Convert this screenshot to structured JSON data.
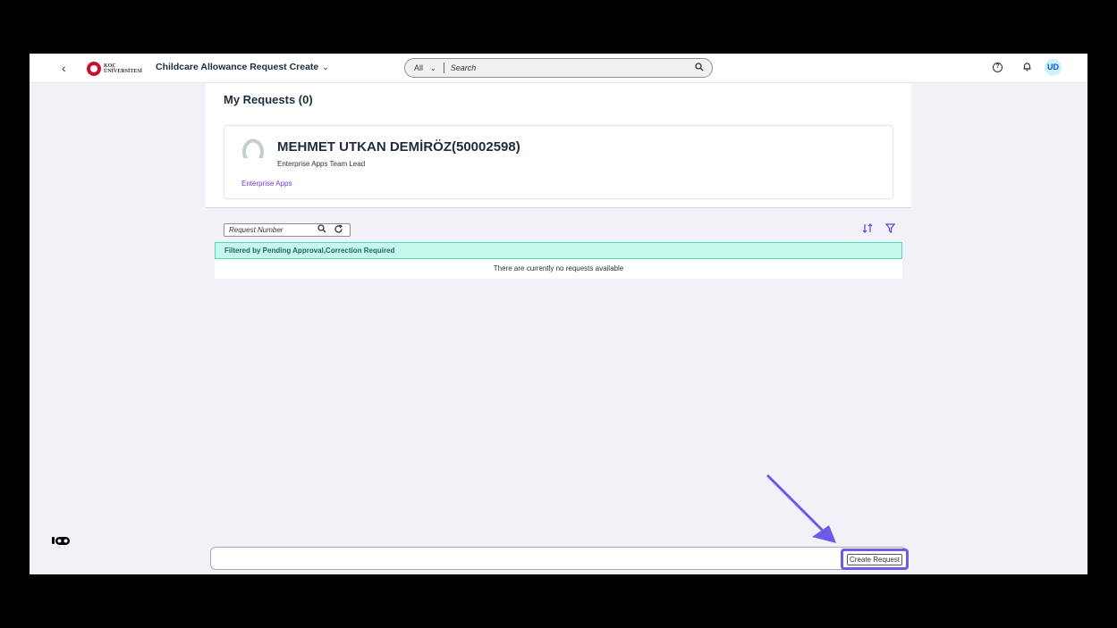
{
  "shell": {
    "back_glyph": "‹",
    "logo_line1": "KOÇ",
    "logo_line2": "ÜNİVERSİTESİ",
    "app_title": "Childcare Allowance Request Create",
    "search_scope": "All",
    "search_placeholder": "Search",
    "avatar_initials": "UD"
  },
  "page": {
    "title": "My Requests (0)"
  },
  "employee": {
    "name": "MEHMET UTKAN DEMİRÖZ(50002598)",
    "role": "Enterprise Apps Team Lead",
    "department": "Enterprise Apps"
  },
  "list": {
    "search_placeholder": "Request Number",
    "filter_text": "Filtered by Pending Approval,Correction Required",
    "empty_text": "There are currently no requests available"
  },
  "footer": {
    "create_label": "Create Request"
  },
  "colors": {
    "accent": "#6b5be8",
    "link": "#6b3fd4",
    "filter_bg": "#c6f7ec"
  }
}
